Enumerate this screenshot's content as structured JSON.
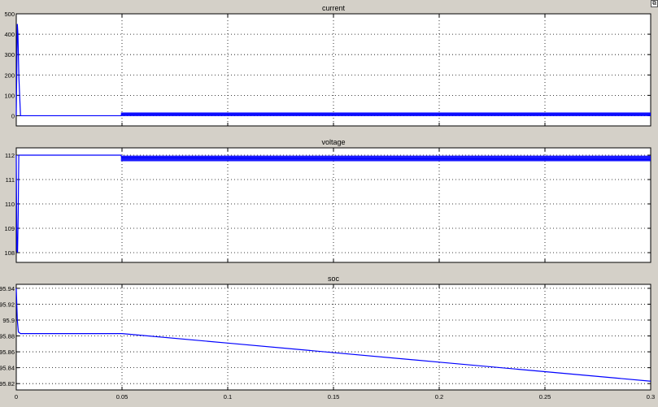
{
  "chart_data": [
    {
      "type": "line",
      "title": "current",
      "xlim": [
        0,
        0.3
      ],
      "ylim": [
        -50,
        500
      ],
      "yticks": [
        0,
        100,
        200,
        300,
        400,
        500
      ],
      "grid": true,
      "line_color": "#0000ff",
      "series": [
        {
          "x": [
            0,
            0.0005,
            0.0008,
            0.0012,
            0.002,
            0.003,
            0.0049,
            0.0495,
            0.05,
            0.1,
            0.15,
            0.2,
            0.25,
            0.3
          ],
          "y": [
            0,
            450,
            400,
            200,
            0,
            0,
            0,
            0,
            8,
            8,
            8,
            8,
            8,
            8
          ],
          "band": [
            0.0495,
            0.3,
            -2,
            16
          ]
        }
      ]
    },
    {
      "type": "line",
      "title": "voltage",
      "xlim": [
        0,
        0.3
      ],
      "ylim": [
        107.6,
        112.3
      ],
      "yticks": [
        108,
        109,
        110,
        111,
        112
      ],
      "grid": true,
      "line_color": "#0000ff",
      "series": [
        {
          "x": [
            0,
            0.0003,
            0.0006,
            0.0009,
            0.0012,
            0.002,
            0.0495,
            0.05,
            0.1,
            0.15,
            0.2,
            0.25,
            0.3
          ],
          "y": [
            112,
            108.1,
            108,
            109.5,
            112,
            112,
            112,
            111.9,
            111.88,
            111.86,
            111.85,
            111.84,
            111.82
          ],
          "band": [
            0.0495,
            0.3,
            111.75,
            111.98
          ]
        }
      ]
    },
    {
      "type": "line",
      "title": "soc",
      "xlim": [
        0,
        0.3
      ],
      "ylim": [
        95.812,
        95.945
      ],
      "yticks": [
        95.82,
        95.84,
        95.86,
        95.88,
        95.9,
        95.92,
        95.94
      ],
      "ytick_labels": [
        "95.82",
        "95.84",
        "95.86",
        "95.88",
        "95.9",
        "95.92",
        "95.94"
      ],
      "xticks": [
        0,
        0.05,
        0.1,
        0.15,
        0.2,
        0.25,
        0.3
      ],
      "xtick_labels": [
        "0",
        "0.05",
        "0.1",
        "0.15",
        "0.2",
        "0.25",
        "0.3"
      ],
      "grid": true,
      "line_color": "#0000ff",
      "series": [
        {
          "x": [
            0,
            0.0005,
            0.001,
            0.002,
            0.05,
            0.1,
            0.15,
            0.2,
            0.25,
            0.3
          ],
          "y": [
            95.94,
            95.9,
            95.885,
            95.883,
            95.883,
            95.871,
            95.859,
            95.847,
            95.835,
            95.823
          ]
        }
      ]
    }
  ],
  "window": {
    "corner_glyph": "⧉"
  }
}
